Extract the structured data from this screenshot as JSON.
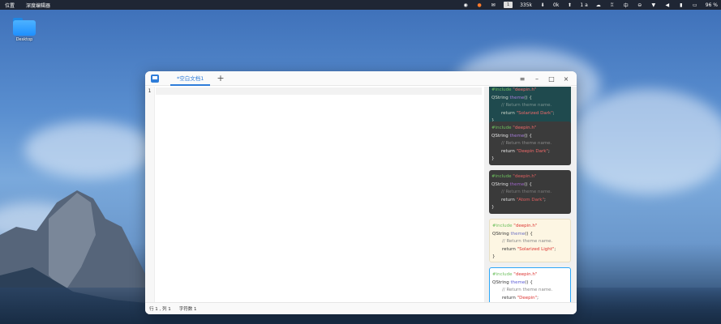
{
  "top_bar": {
    "menu": [
      "位置",
      "深度编辑器"
    ],
    "tray": {
      "keyboard_layout": "1",
      "network_speed": "335k",
      "unit_small": "0k",
      "input_method": "1 a",
      "battery": "96 %"
    }
  },
  "desktop": {
    "icon_label": "Desktop"
  },
  "editor": {
    "tab_title": "*空白文档1",
    "add_tab_icon": "+",
    "line_numbers": [
      "1"
    ],
    "window_controls": [
      "≡",
      "–",
      "□",
      "×"
    ],
    "status": {
      "position": "行 1 , 列 1",
      "char_count": "字符数 1"
    }
  },
  "themes": [
    {
      "name": "Solarized Dark",
      "include": "#include",
      "header": "\"deepin.h\"",
      "qstring": "QString",
      "func": "theme",
      "paren": "() {",
      "comment": "// Return theme name.",
      "return_kw": "return",
      "value": "\"Solarized Dark\"",
      "semi": ";",
      "close": "}"
    },
    {
      "name": "Deepin Dark",
      "include": "#include",
      "header": "\"deepin.h\"",
      "qstring": "QString",
      "func": "theme",
      "paren": "() {",
      "comment": "// Return theme name.",
      "return_kw": "return",
      "value": "\"Deepin Dark\"",
      "semi": ";",
      "close": "}"
    },
    {
      "name": "Atom Dark",
      "include": "#include",
      "header": "\"deepin.h\"",
      "qstring": "QString",
      "func": "theme",
      "paren": "() {",
      "comment": "// Return theme name.",
      "return_kw": "return",
      "value": "\"Atom Dark\"",
      "semi": ";",
      "close": "}"
    },
    {
      "name": "Solarized Light",
      "include": "#include",
      "header": "\"deepin.h\"",
      "qstring": "QString",
      "func": "theme",
      "paren": "() {",
      "comment": "// Return theme name.",
      "return_kw": "return",
      "value": "\"Solarized Light\"",
      "semi": ";",
      "close": "}"
    },
    {
      "name": "Deepin",
      "include": "#include",
      "header": "\"deepin.h\"",
      "qstring": "QString",
      "func": "theme",
      "paren": "() {",
      "comment": "// Return theme name.",
      "return_kw": "return",
      "value": "\"Deepin\"",
      "semi": ";",
      "close": "}"
    }
  ],
  "colors": {
    "accent": "#2f7dd9",
    "selected_theme_border": "#2ca7f8"
  }
}
